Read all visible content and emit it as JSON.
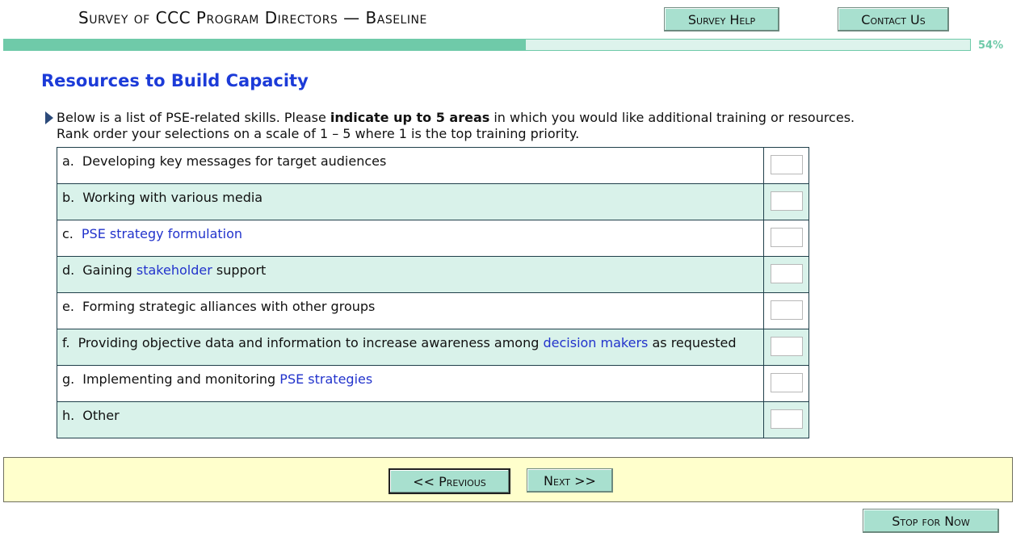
{
  "header": {
    "title": "Survey of CCC Program Directors — Baseline",
    "help_label": "Survey Help",
    "contact_label": "Contact Us"
  },
  "progress": {
    "value": 0.54,
    "label": "54%",
    "fill_color": "#6fcaa9",
    "track_color": "#ddf3ec"
  },
  "section": {
    "title": "Resources to Build Capacity"
  },
  "instructions": {
    "part1": "Below is a list of PSE-related skills.  Please ",
    "emphasis": "indicate up to 5 areas",
    "part2": " in which you would like additional training or resources.",
    "line2": "Rank order your selections on a scale of 1 – 5 where 1 is the top training priority."
  },
  "items": [
    {
      "letter": "a.",
      "segments": [
        {
          "text": "Developing key messages for target audiences",
          "link": false
        }
      ],
      "value": ""
    },
    {
      "letter": "b.",
      "segments": [
        {
          "text": "Working with various media",
          "link": false
        }
      ],
      "value": ""
    },
    {
      "letter": "c.",
      "segments": [
        {
          "text": "PSE strategy formulation",
          "link": true
        }
      ],
      "value": ""
    },
    {
      "letter": "d.",
      "segments": [
        {
          "text": "Gaining ",
          "link": false
        },
        {
          "text": "stakeholder",
          "link": true
        },
        {
          "text": " support",
          "link": false
        }
      ],
      "value": ""
    },
    {
      "letter": "e.",
      "segments": [
        {
          "text": "Forming strategic alliances with other groups",
          "link": false
        }
      ],
      "value": ""
    },
    {
      "letter": "f.",
      "segments": [
        {
          "text": "Providing objective data and information to increase awareness among ",
          "link": false
        },
        {
          "text": "decision makers",
          "link": true
        },
        {
          "text": " as requested",
          "link": false
        }
      ],
      "value": ""
    },
    {
      "letter": "g.",
      "segments": [
        {
          "text": "Implementing and monitoring ",
          "link": false
        },
        {
          "text": "PSE strategies",
          "link": true
        }
      ],
      "value": ""
    },
    {
      "letter": "h.",
      "segments": [
        {
          "text": "Other",
          "link": false
        }
      ],
      "value": ""
    }
  ],
  "nav": {
    "previous_label": "<< Previous",
    "next_label": "Next >>",
    "stop_label": "Stop for Now"
  },
  "colors": {
    "accent": "#1c3bd8",
    "link": "#2233cc",
    "button": "#a8e0cf",
    "row_alt": "#d9f2ea",
    "nav_bg": "#ffffcc"
  }
}
